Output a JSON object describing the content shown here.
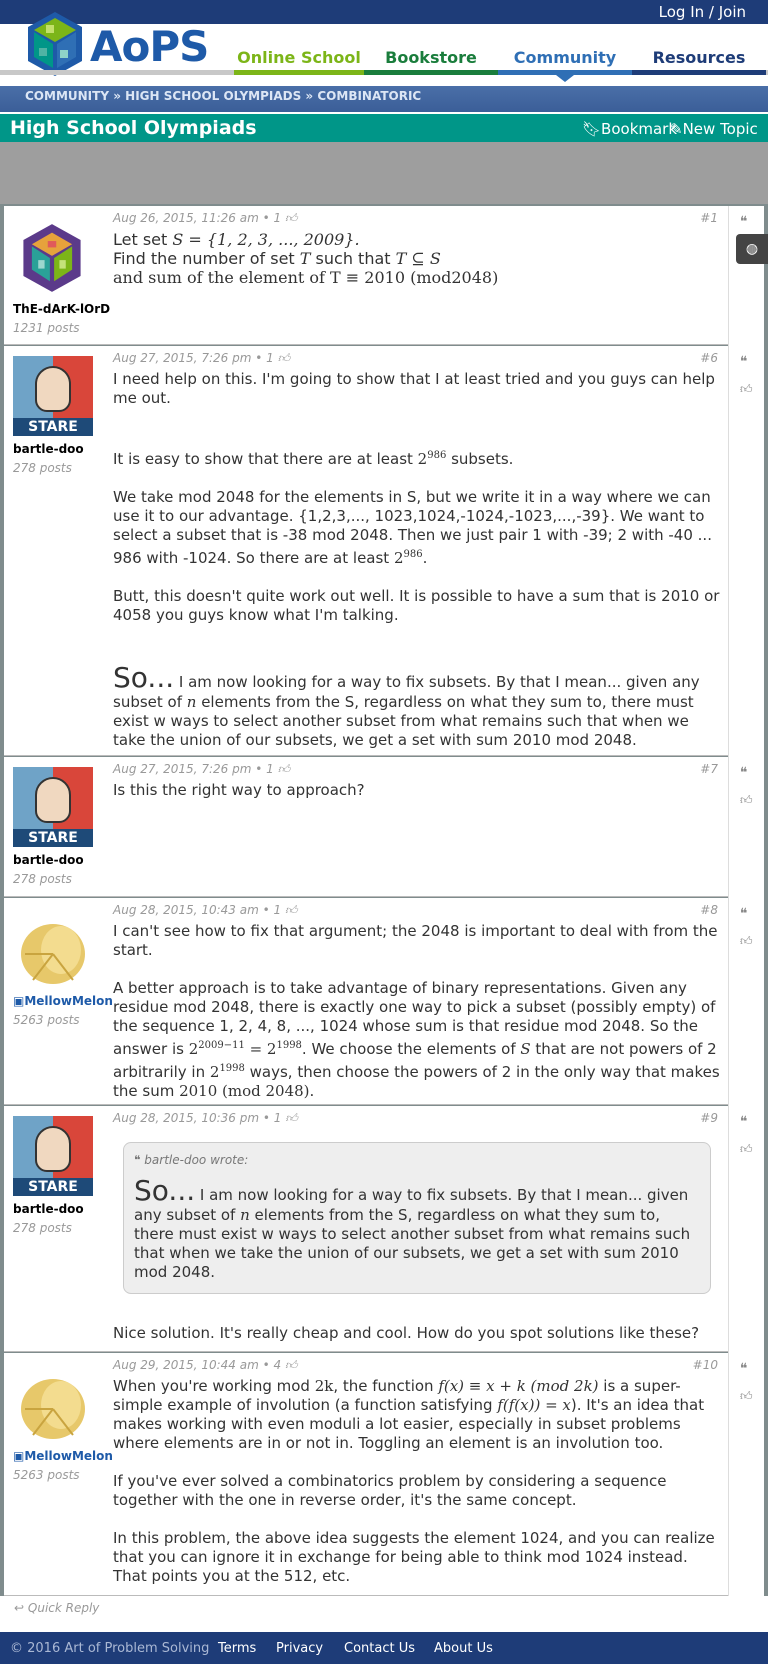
{
  "header": {
    "login": "Log In / Join",
    "logo_text": "AoPS",
    "nav": [
      "Online School",
      "Bookstore",
      "Community",
      "Resources"
    ],
    "colors": {
      "online": "#7cb518",
      "bookstore": "#1a7d3c",
      "community": "#2f6fb5",
      "resources": "#1e3c78"
    }
  },
  "breadcrumb": {
    "a": "COMMUNITY",
    "sep": "»",
    "b": "HIGH SCHOOL OLYMPIADS",
    "c": "COMBINATORIC"
  },
  "forum": {
    "title": "High School Olympiads",
    "bookmark": "Bookmark",
    "new_topic": "New Topic"
  },
  "posts": [
    {
      "user": "ThE-dArK-lOrD",
      "count": "1231 posts",
      "meta": "Aug 26, 2015, 11:26 am • 1",
      "num": "#1"
    },
    {
      "user": "bartle-doo",
      "count": "278 posts",
      "meta": "Aug 27, 2015, 7:26 pm • 1",
      "num": "#6"
    },
    {
      "user": "bartle-doo",
      "count": "278 posts",
      "meta": "Aug 27, 2015, 7:26 pm • 1",
      "num": "#7"
    },
    {
      "user": "MellowMelon",
      "count": "5263 posts",
      "meta": "Aug 28, 2015, 10:43 am • 1",
      "num": "#8"
    },
    {
      "user": "bartle-doo",
      "count": "278 posts",
      "meta": "Aug 28, 2015, 10:36 pm • 1",
      "num": "#9"
    },
    {
      "user": "MellowMelon",
      "count": "5263 posts",
      "meta": "Aug 29, 2015, 10:44 am • 4",
      "num": "#10"
    }
  ],
  "text": {
    "p1_l1": "Let set ",
    "p1_l1m": "S = {1, 2, 3, ..., 2009}.",
    "p1_l2": "Find the number of set ",
    "p1_l2m": "T",
    "p1_l2b": " such that ",
    "p1_l2m2": "T ⊆ S",
    "p1_l3": "and sum of the element of T ≡ 2010 (mod2048)",
    "p6_a": "I need help on this. I'm going to show that I at least tried and you guys can help me out.",
    "p6_b": "It is easy to show that there are at least ",
    "p6_b_exp": "986",
    "p6_b_end": " subsets.",
    "p6_c": "We take mod 2048 for the elements in S, but we write it in a way where we can use it to our advantage. {1,2,3,..., 1023,1024,-1024,-1023,...,-39}. We want to select a subset that is -38 mod 2048. Then we just pair 1 with -39; 2 with -40 ... 986 with -1024. So there are at least ",
    "p6_c_exp": "986",
    "p6_d": "Butt, this doesn't quite work out well. It is possible to have a sum that is 2010 or 4058 you guys know what I'm talking.",
    "p6_so": "So...",
    "p6_e": " I am now looking for a way to fix subsets. By that I mean... given any subset of ",
    "p6_e_n": "n",
    "p6_e2": " elements from the S, regardless on what they sum to, there must exist w ways to select another subset from what remains such that when we take the union of our subsets, we get a set with sum 2010 mod 2048.",
    "p7": "Is this the right way to approach?",
    "p8_a": "I can't see how to fix that argument; the 2048 is important to deal with from the start.",
    "p8_b1": "A better approach is to take advantage of binary representations. Given any residue mod 2048, there is exactly one way to pick a subset (possibly empty) of the sequence 1, 2, 4, 8, ..., 1024 whose sum is that residue mod 2048. So the answer is ",
    "p8_b_exp1": "2009−11",
    "p8_b_eq": " = 2",
    "p8_b_exp2": "1998",
    "p8_b2": ". We choose the elements of ",
    "p8_b_S": "S",
    "p8_b3": " that are not powers of 2 arbitrarily in ",
    "p8_b_exp3": "1998",
    "p8_b4": " ways, then choose the powers of 2 in the only way that makes the sum ",
    "p8_b_mod": "2010 (mod 2048).",
    "p9_quote_head": "bartle-doo wrote:",
    "p9_reply": "Nice solution. It's really cheap and cool. How do you spot solutions like these?",
    "p10_a1": "When you're working mod ",
    "p10_a_2k": "2k",
    "p10_a2": ", the function ",
    "p10_a_f": "f(x) ≡ x + k (mod 2k)",
    "p10_a3": " is a super-simple example of involution (a function satisfying ",
    "p10_a_ff": "f(f(x)) = x",
    "p10_a4": "). It's an idea that makes working with even moduli a lot easier, especially in subset problems where elements are in or not in. Toggling an element is an involution too.",
    "p10_b": "If you've ever solved a combinatorics problem by considering a sequence together with the one in reverse order, it's the same concept.",
    "p10_c": "In this problem, the above idea suggests the element 1024, and you can realize that you can ignore it in exchange for being able to think mod 1024 instead. That points you at the 512, etc.",
    "two": "2"
  },
  "quick_reply": "Quick Reply",
  "footer": {
    "copy": "© 2016 Art of Problem Solving",
    "terms": "Terms",
    "privacy": "Privacy",
    "contact": "Contact Us",
    "about": "About Us"
  }
}
